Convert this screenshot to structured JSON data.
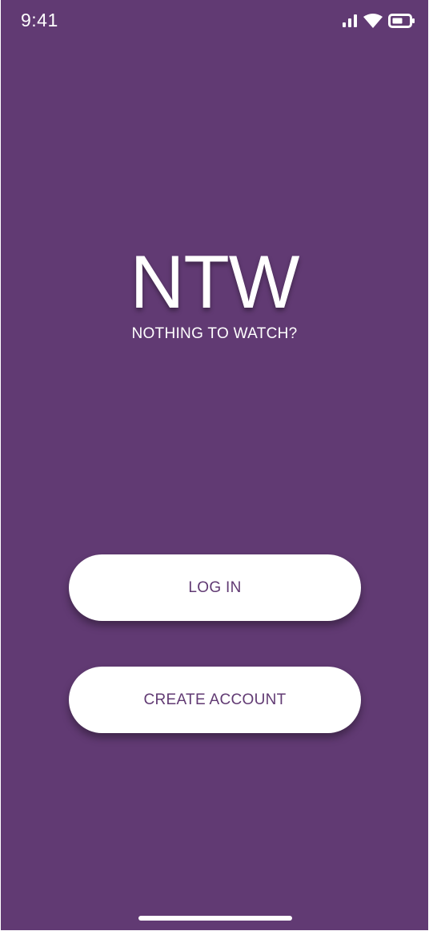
{
  "status_bar": {
    "time": "9:41",
    "icons": [
      "cellular-signal-icon",
      "wifi-icon",
      "battery-icon"
    ]
  },
  "colors": {
    "background": "#613a73",
    "button_background": "#ffffff",
    "button_text": "#613a73",
    "text": "#ffffff"
  },
  "logo": {
    "title": "NTW",
    "tagline": "NOTHING TO WATCH?"
  },
  "actions": {
    "login_label": "LOG IN",
    "create_account_label": "CREATE ACCOUNT"
  }
}
